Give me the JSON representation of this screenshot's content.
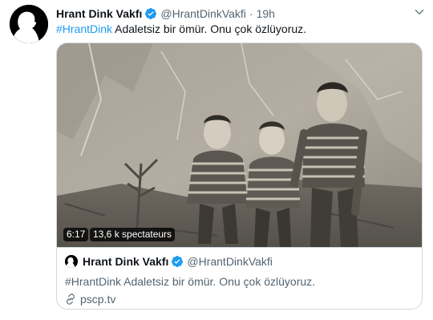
{
  "tweet": {
    "display_name": "Hrant Dink Vakfı",
    "handle": "@HrantDinkVakfi",
    "separator": "·",
    "time": "19h",
    "hashtag": "#HrantDink",
    "body": " Adaletsiz bir ömür. Onu çok özlüyoruz."
  },
  "media": {
    "duration": "6:17",
    "views": "13,6 k spectateurs"
  },
  "card": {
    "display_name": "Hrant Dink Vakfı",
    "handle": "@HrantDinkVakfi",
    "text": "#HrantDink Adaletsiz bir ömür. Onu çok özlüyoruz.",
    "link": "pscp.tv"
  },
  "colors": {
    "accent": "#1d9bf0",
    "secondary_text": "#536471",
    "border": "#cfd9de"
  },
  "icons": {
    "verified": "verified-badge-icon",
    "caret": "chevron-down-icon",
    "link": "link-icon"
  }
}
